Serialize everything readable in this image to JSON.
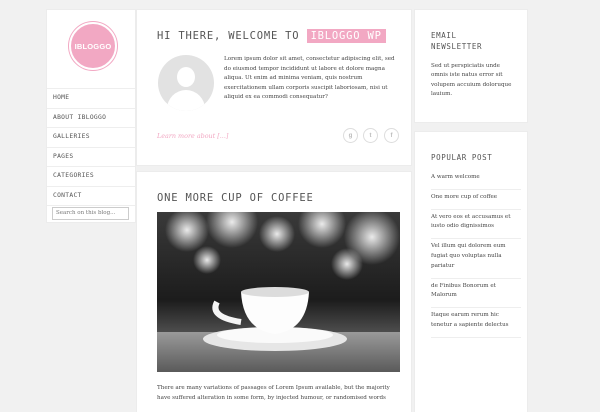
{
  "brand": {
    "logo_text": "IBLOGGO",
    "accent": "#f2a8c3"
  },
  "nav": {
    "items": [
      "HOME",
      "ABOUT IBLOGGO",
      "GALLERIES",
      "PAGES",
      "CATEGORIES",
      "CONTACT"
    ]
  },
  "search": {
    "placeholder": "Search on this blog..."
  },
  "post1": {
    "title_prefix": "HI THERE, WELCOME TO",
    "title_highlight": "IBLOGGO WP",
    "excerpt": "Lorem ipsum dolor sit amet, consectetur adipiscing elit, sed do eiusmod tempor incididunt ut labore et dolore magna aliqua. Ut enim ad minima veniam, quis nostrum exercitationem ullam corporis suscipit laboriosam, nisi ut aliquid ex ea commodi consequatur?",
    "read_more": "Learn more about [...]",
    "social": [
      "g",
      "t",
      "f"
    ]
  },
  "post2": {
    "title": "ONE MORE CUP OF COFFEE",
    "body": "There are many variations of passages of Lorem Ipsum available, but the majority have suffered alteration in some form, by injected humour, or randomised words"
  },
  "newsletter": {
    "title": "EMAIL NEWSLETTER",
    "text": "Sed ut perspiciatis unde omnis iste natus error sit volupem accuium doloruque lauium."
  },
  "popular": {
    "title": "POPULAR POST",
    "items": [
      "A warm welcome",
      "One more cup of coffee",
      "At vero eos et accusamus et iusto odio dignissimos",
      "Vel illum qui dolorem eum fugiat quo voluptas nulla pariatur",
      "de Finibus Bonorum et Malorum",
      "Itaque earum rerum hic tenetur a sapiente delectus"
    ]
  }
}
